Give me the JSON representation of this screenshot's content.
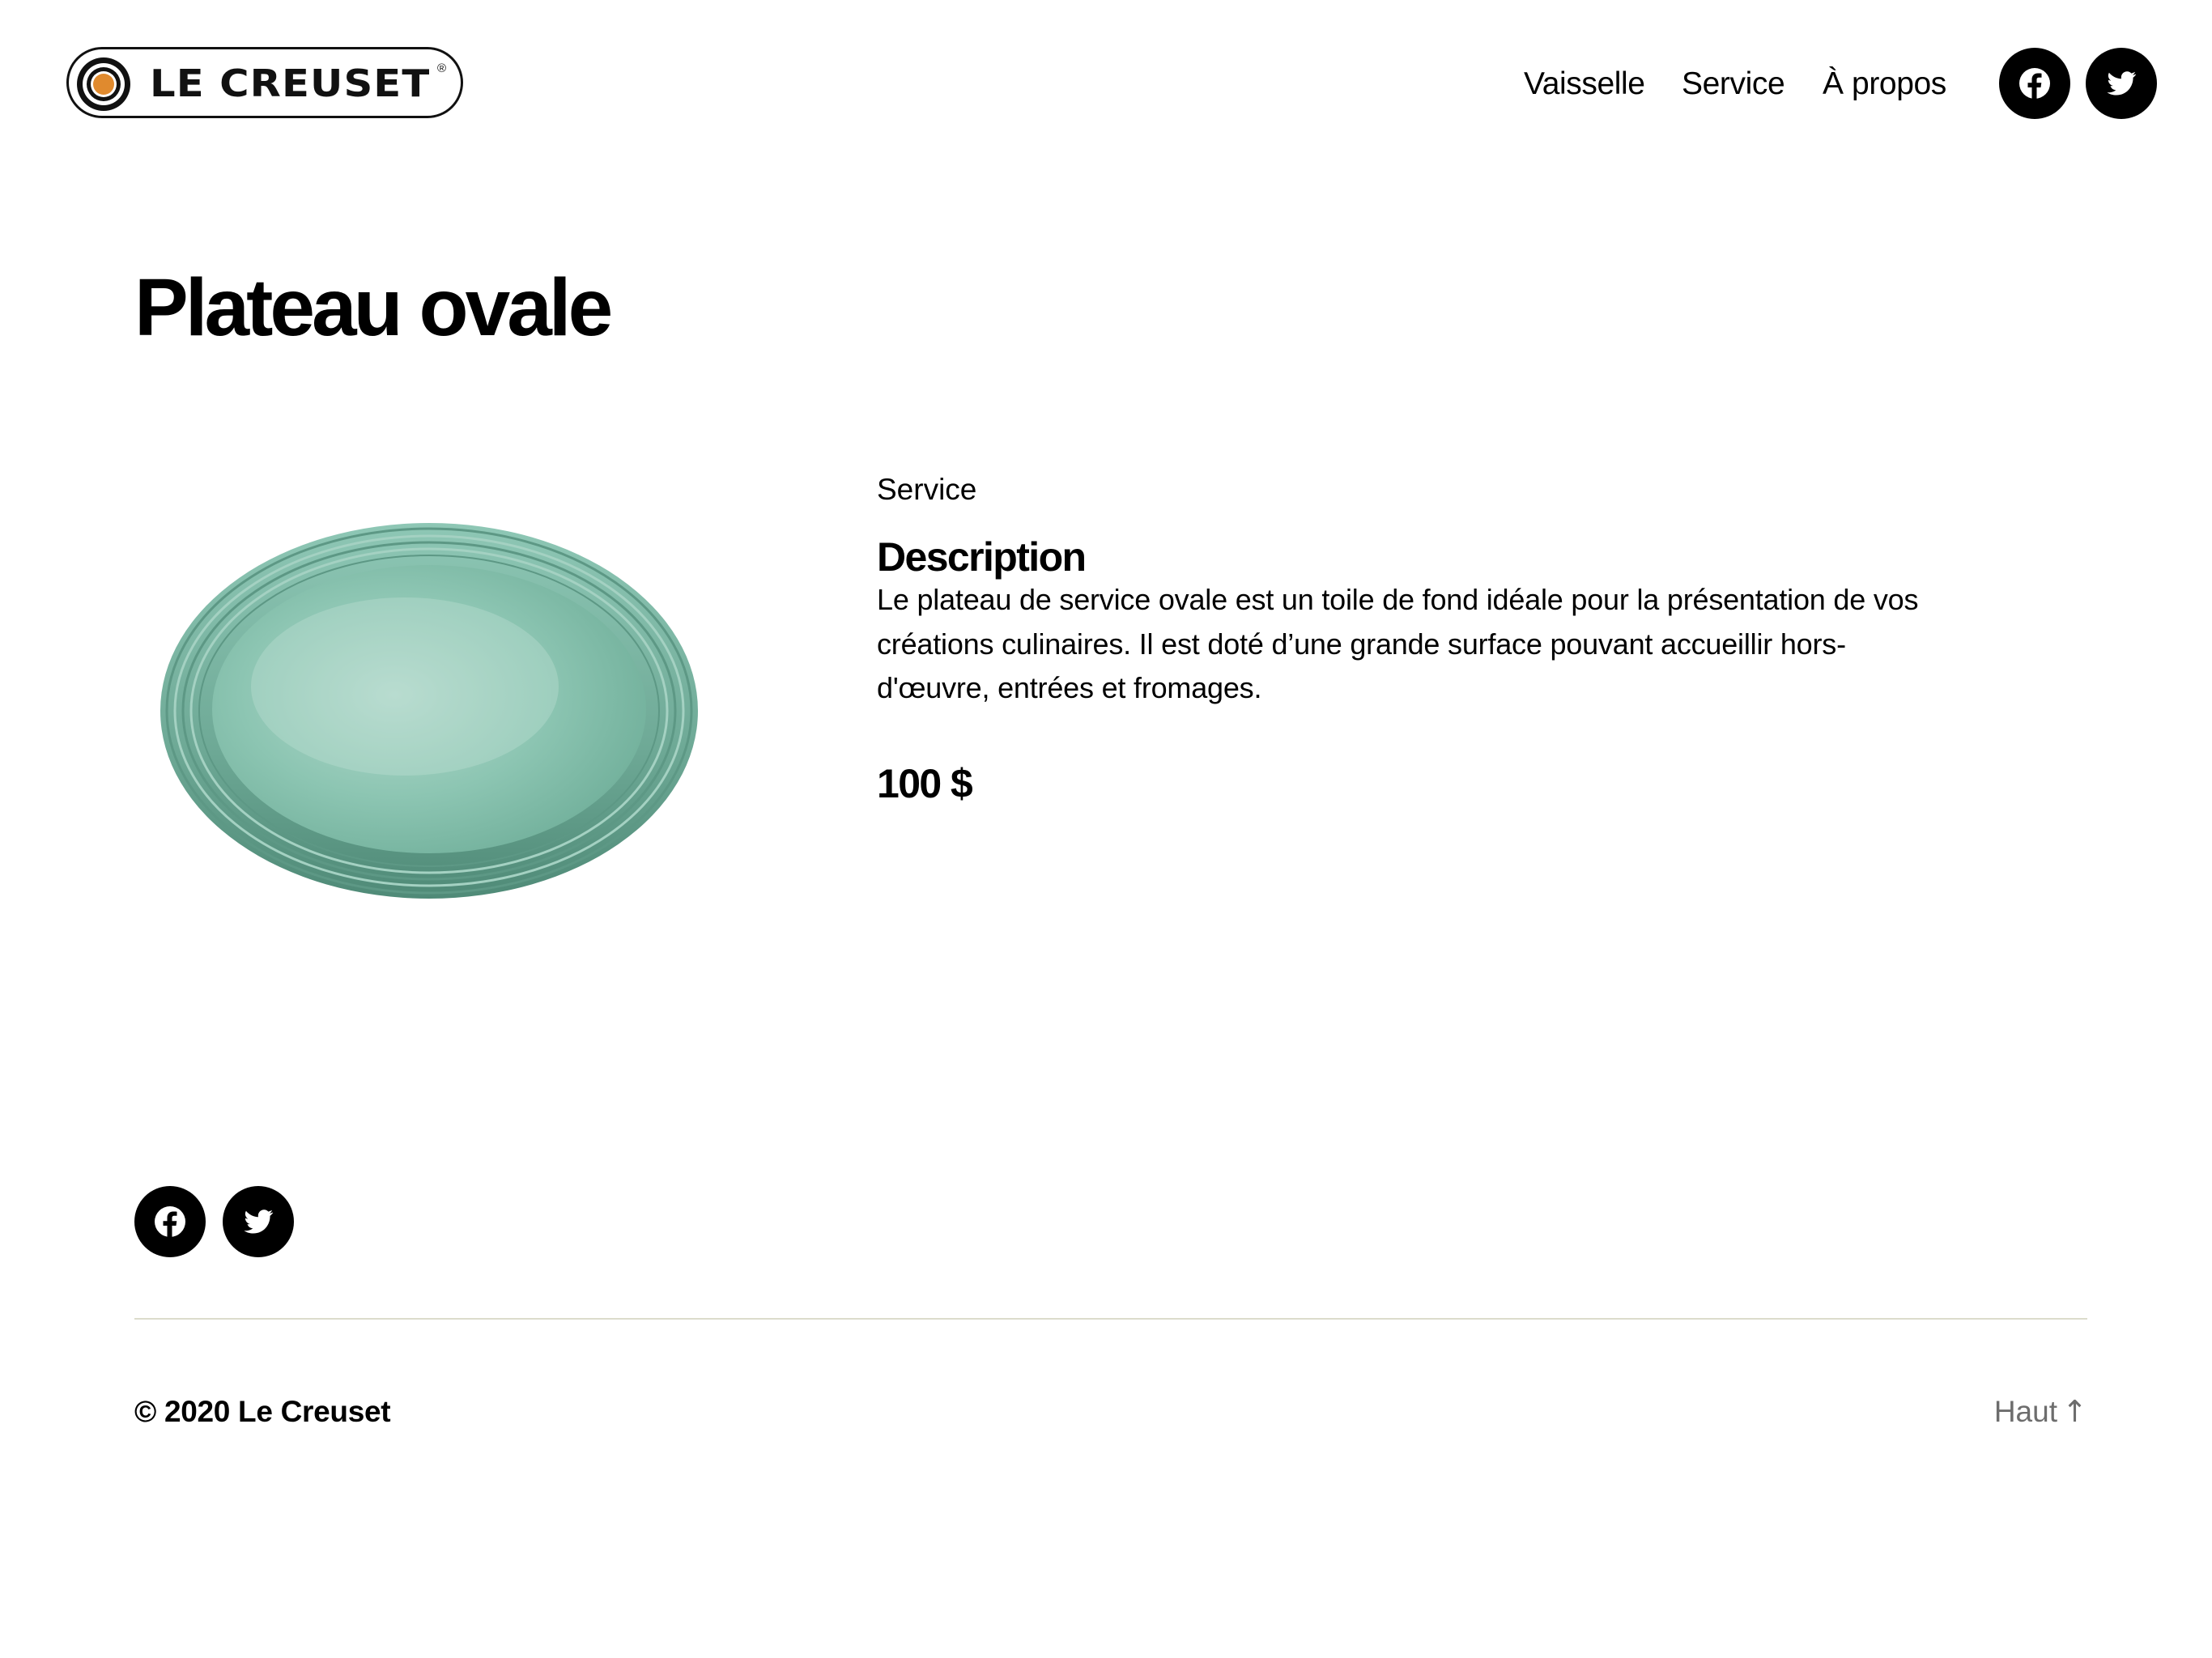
{
  "header": {
    "logo_text": "LE CREUSET",
    "logo_reg": "®",
    "nav": [
      {
        "label": "Vaisselle"
      },
      {
        "label": "Service"
      },
      {
        "label": "À propos"
      }
    ],
    "social": [
      {
        "icon": "facebook-icon"
      },
      {
        "icon": "twitter-icon"
      }
    ]
  },
  "product": {
    "title": "Plateau ovale",
    "category": "Service",
    "description_heading": "Description",
    "description": "Le plateau de service ovale est un toile de fond idéale pour la présentation de vos créations culinaires. Il est doté d’une grande surface pouvant accueillir hors-d'œuvre, entrées et fromages.",
    "price": "100 $",
    "image_color": "#7fbaa7"
  },
  "footer": {
    "social": [
      {
        "icon": "facebook-icon"
      },
      {
        "icon": "twitter-icon"
      }
    ],
    "copyright": "© 2020 Le Creuset",
    "back_to_top": "Haut",
    "back_to_top_arrow": "↑"
  },
  "colors": {
    "text": "#000000",
    "muted": "#6d6d6d",
    "divider": "#dcdccc",
    "logo_accent": "#e08a2e"
  }
}
